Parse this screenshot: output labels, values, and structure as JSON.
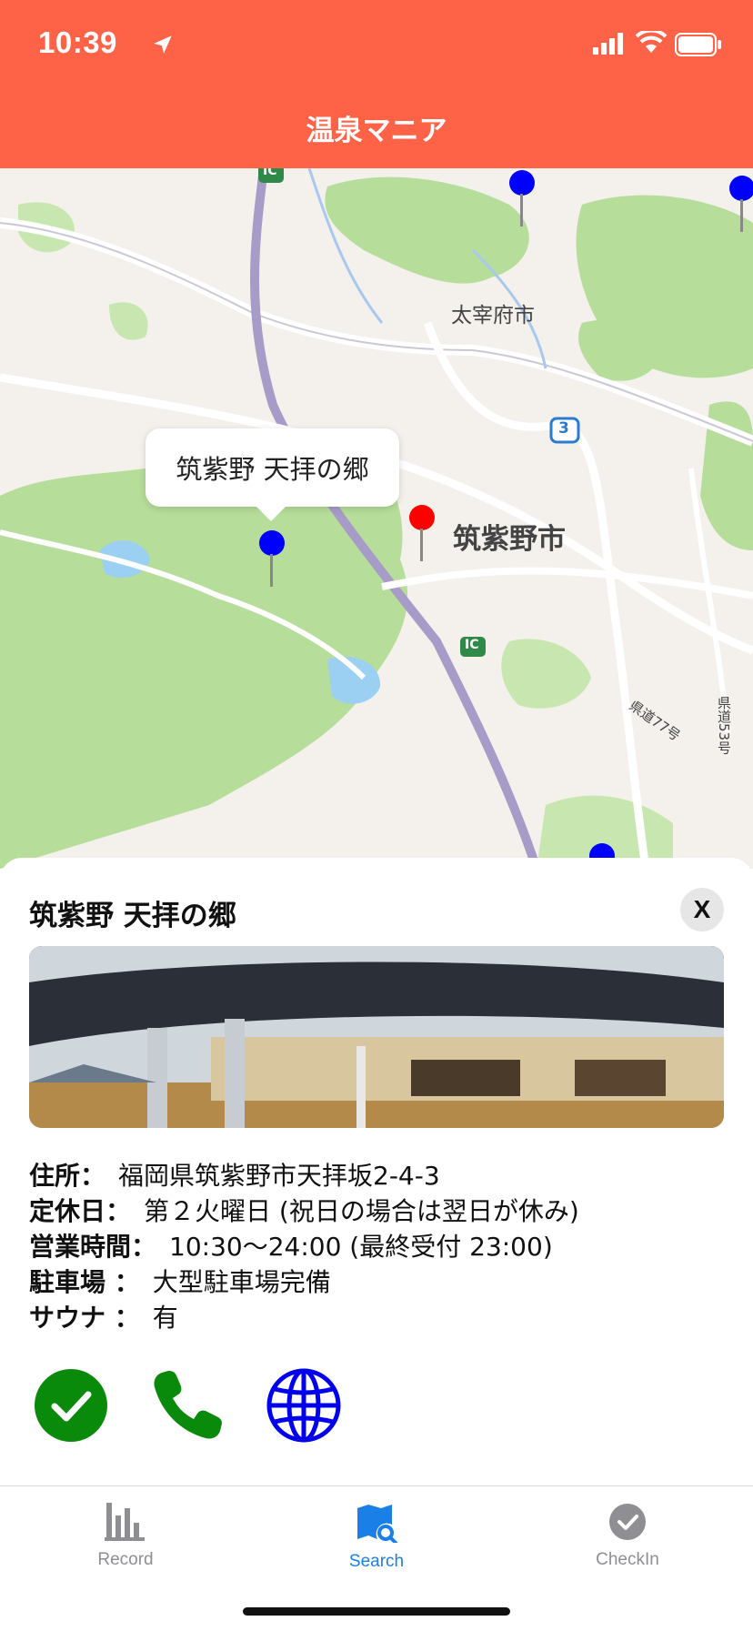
{
  "status_bar": {
    "time": "10:39"
  },
  "nav": {
    "title": "温泉マニア"
  },
  "map": {
    "labels": {
      "dazaifu": "太宰府市",
      "chikushino": "筑紫野市",
      "route_3": "3",
      "ic_top": "IC",
      "ic_mid": "IC",
      "prefectural_53": "県道53号",
      "prefectural_77": "県道77号"
    },
    "callout": "筑紫野 天拝の郷",
    "pins": [
      {
        "color": "#0000ff"
      },
      {
        "color": "#0000ff"
      },
      {
        "color": "#0000ff"
      },
      {
        "color": "#ff0000"
      },
      {
        "color": "#0000ff"
      }
    ]
  },
  "detail": {
    "title": "筑紫野 天拝の郷",
    "close_label": "X",
    "rows": [
      {
        "key": "住所：",
        "value": "福岡県筑紫野市天拝坂2-4-3"
      },
      {
        "key": "定休日：",
        "value": "第２火曜日 (祝日の場合は翌日が休み)"
      },
      {
        "key": "営業時間：",
        "value": "10:30〜24:00 (最終受付 23:00)"
      },
      {
        "key": "駐車場 ：",
        "value": "大型駐車場完備"
      },
      {
        "key": "サウナ ：",
        "value": "有"
      }
    ],
    "actions": [
      {
        "icon": "checkmark-circle-icon",
        "color": "#0a8a0a"
      },
      {
        "icon": "phone-icon",
        "color": "#0a8a0a"
      },
      {
        "icon": "globe-icon",
        "color": "#0000ee"
      }
    ]
  },
  "tabs": [
    {
      "label": "Record",
      "icon": "bar-chart-icon",
      "color": "#8e8e93"
    },
    {
      "label": "Search",
      "icon": "map-search-icon",
      "color": "#1a7fe6"
    },
    {
      "label": "CheckIn",
      "icon": "checkmark-circle-icon",
      "color": "#8e8e93"
    }
  ],
  "colors": {
    "nav_bg": "#ff6347",
    "accent": "#1a7fe6"
  }
}
